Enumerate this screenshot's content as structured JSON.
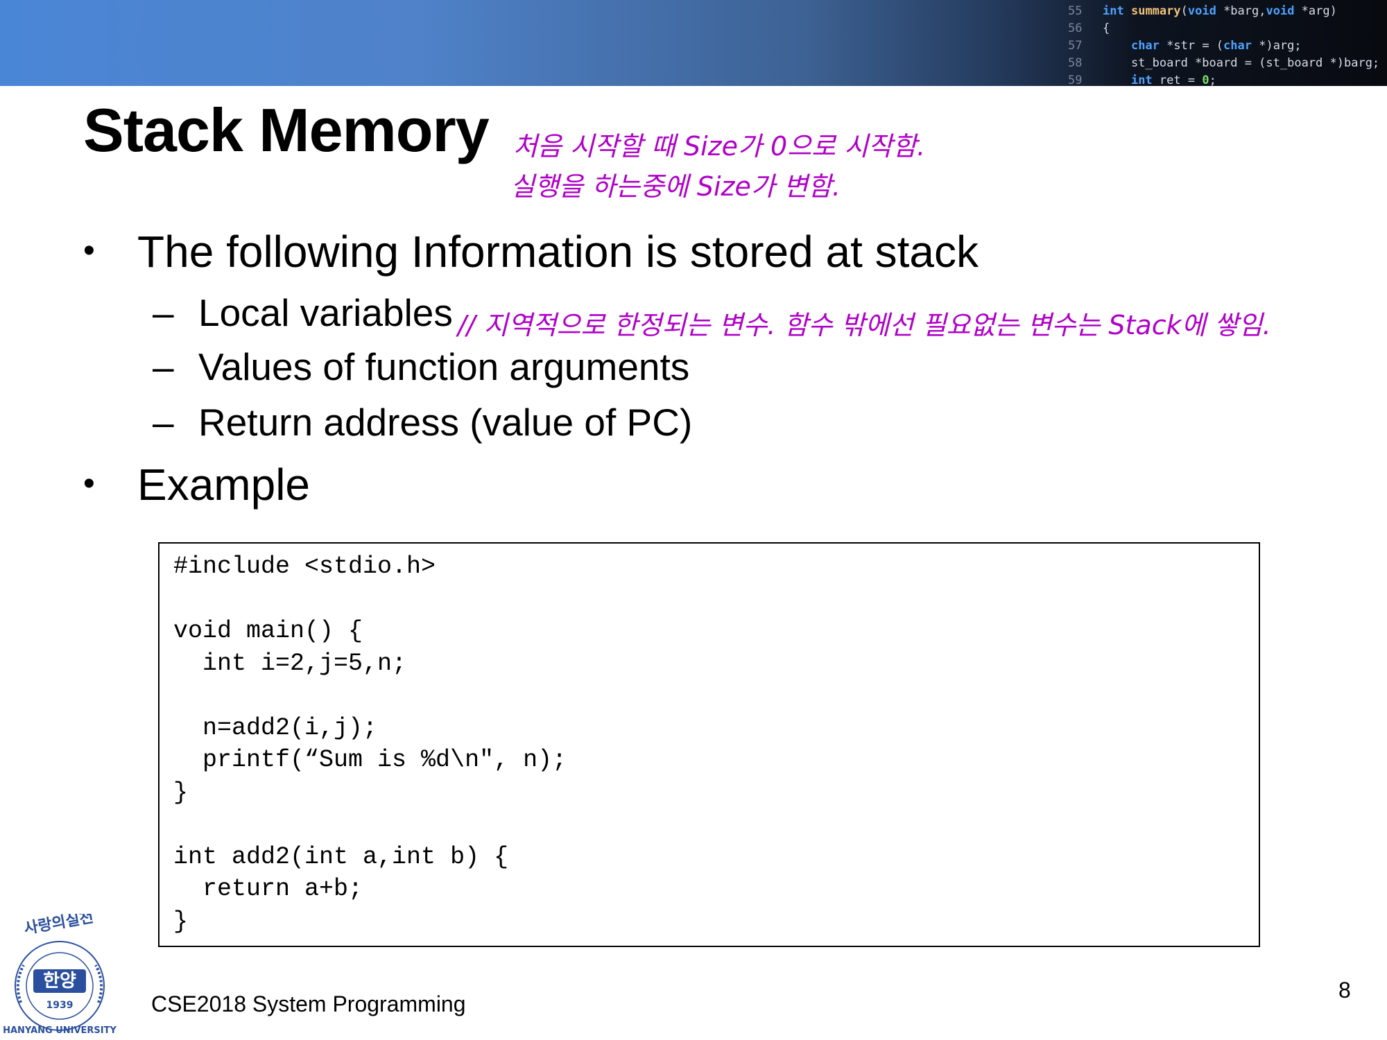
{
  "banner": {
    "code_lines": [
      {
        "num": "55",
        "parts": [
          {
            "t": "int",
            "c": "kw"
          },
          {
            "t": " "
          },
          {
            "t": "summary",
            "c": "fn"
          },
          {
            "t": "("
          },
          {
            "t": "void",
            "c": "kw"
          },
          {
            "t": " *barg,"
          },
          {
            "t": "void",
            "c": "kw"
          },
          {
            "t": " *arg)"
          }
        ]
      },
      {
        "num": "56",
        "parts": [
          {
            "t": "{"
          }
        ]
      },
      {
        "num": "57",
        "parts": [
          {
            "t": "    "
          },
          {
            "t": "char",
            "c": "kw"
          },
          {
            "t": " *str = ("
          },
          {
            "t": "char",
            "c": "kw"
          },
          {
            "t": " *)arg;"
          }
        ]
      },
      {
        "num": "58",
        "parts": [
          {
            "t": "    st_board *board = (st_board *)barg;"
          }
        ]
      },
      {
        "num": "59",
        "parts": [
          {
            "t": "    "
          },
          {
            "t": "int",
            "c": "kw"
          },
          {
            "t": " ret = "
          },
          {
            "t": "0",
            "c": "num"
          },
          {
            "t": ";"
          }
        ]
      }
    ]
  },
  "slide": {
    "title": "Stack Memory",
    "handwritten_notes": {
      "title_line1": "처음 시작할 때 Size가 0으로 시작함.",
      "title_line2": "실행을 하는중에 Size가 변함.",
      "local_vars": "// 지역적으로 한정되는 변수. 함수 밖에선 필요없는 변수는 Stack에 쌓임."
    },
    "bullets": [
      {
        "text": "The following Information is stored at stack",
        "subitems": [
          "Local variables",
          "Values of function arguments",
          "Return address (value of PC)"
        ]
      },
      {
        "text": "Example"
      }
    ],
    "bullet_glyph": "•",
    "dash_glyph": "–",
    "code": "#include <stdio.h>\n\nvoid main() {\n  int i=2,j=5,n;\n\n  n=add2(i,j);\n  printf(“Sum is %d\\n\", n);\n}\n\nint add2(int a,int b) {\n  return a+b;\n}",
    "footer": "CSE2018 System Programming",
    "page_number": "8"
  },
  "logo": {
    "top_text": "사랑의실천",
    "center_text": "한양",
    "year": "1939",
    "bottom_text": "HANYANG UNIVERSITY"
  },
  "colors": {
    "handwriting": "#b000c8",
    "logo_blue": "#2b4f9e"
  }
}
